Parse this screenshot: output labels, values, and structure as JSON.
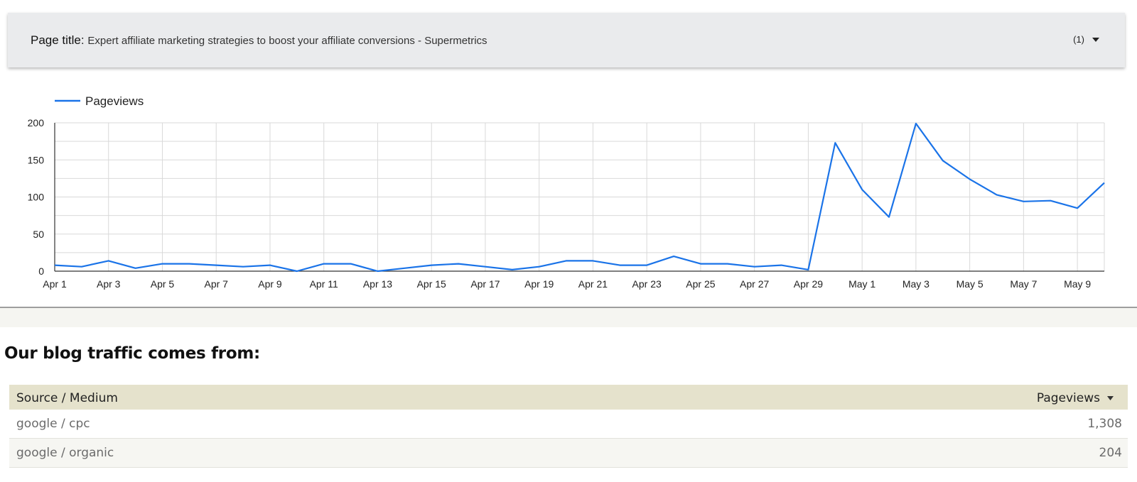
{
  "filter": {
    "name": "Page title",
    "separator": ": ",
    "value": "Expert affiliate marketing strategies to boost your affiliate conversions - Supermetrics",
    "count": "(1)"
  },
  "chart_data": {
    "type": "line",
    "title": "",
    "xlabel": "",
    "ylabel": "",
    "legend_position": "top-left",
    "grid": true,
    "ylim": [
      0,
      200
    ],
    "yticks": [
      0,
      50,
      100,
      150,
      200
    ],
    "x": [
      "Apr 1",
      "Apr 2",
      "Apr 3",
      "Apr 4",
      "Apr 5",
      "Apr 6",
      "Apr 7",
      "Apr 8",
      "Apr 9",
      "Apr 10",
      "Apr 11",
      "Apr 12",
      "Apr 13",
      "Apr 14",
      "Apr 15",
      "Apr 16",
      "Apr 17",
      "Apr 18",
      "Apr 19",
      "Apr 20",
      "Apr 21",
      "Apr 22",
      "Apr 23",
      "Apr 24",
      "Apr 25",
      "Apr 26",
      "Apr 27",
      "Apr 28",
      "Apr 29",
      "Apr 30",
      "May 1",
      "May 2",
      "May 3",
      "May 4",
      "May 5",
      "May 6",
      "May 7",
      "May 8",
      "May 9",
      "May 10"
    ],
    "x_tick_labels": [
      "Apr 1",
      "Apr 3",
      "Apr 5",
      "Apr 7",
      "Apr 9",
      "Apr 11",
      "Apr 13",
      "Apr 15",
      "Apr 17",
      "Apr 19",
      "Apr 21",
      "Apr 23",
      "Apr 25",
      "Apr 27",
      "Apr 29",
      "May 1",
      "May 3",
      "May 5",
      "May 7",
      "May 9"
    ],
    "series": [
      {
        "name": "Pageviews",
        "color": "#1a73e8",
        "values": [
          8,
          6,
          14,
          4,
          10,
          10,
          8,
          6,
          8,
          0,
          10,
          10,
          0,
          4,
          8,
          10,
          6,
          2,
          6,
          14,
          14,
          8,
          8,
          20,
          10,
          10,
          6,
          8,
          2,
          173,
          110,
          73,
          199,
          149,
          124,
          103,
          94,
          95,
          85,
          119
        ]
      }
    ]
  },
  "section": {
    "title": "Our blog traffic comes from:"
  },
  "table": {
    "col_source": "Source / Medium",
    "col_pageviews": "Pageviews",
    "rows": [
      {
        "source": "google / cpc",
        "pageviews": "1,308"
      },
      {
        "source": "google / organic",
        "pageviews": "204"
      }
    ]
  }
}
